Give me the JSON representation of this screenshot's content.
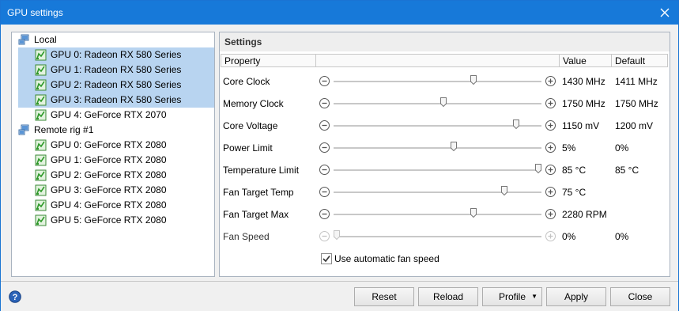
{
  "window": {
    "title": "GPU settings"
  },
  "tree": [
    {
      "label": "Local",
      "type": "group",
      "selected": false
    },
    {
      "label": "GPU 0: Radeon RX 580 Series",
      "type": "gpu",
      "selected": true
    },
    {
      "label": "GPU 1: Radeon RX 580 Series",
      "type": "gpu",
      "selected": true
    },
    {
      "label": "GPU 2: Radeon RX 580 Series",
      "type": "gpu",
      "selected": true
    },
    {
      "label": "GPU 3: Radeon RX 580 Series",
      "type": "gpu",
      "selected": true
    },
    {
      "label": "GPU 4: GeForce RTX 2070",
      "type": "gpu",
      "selected": false
    },
    {
      "label": "Remote rig #1",
      "type": "group",
      "selected": false
    },
    {
      "label": "GPU 0: GeForce RTX 2080",
      "type": "gpu",
      "selected": false
    },
    {
      "label": "GPU 1: GeForce RTX 2080",
      "type": "gpu",
      "selected": false
    },
    {
      "label": "GPU 2: GeForce RTX 2080",
      "type": "gpu",
      "selected": false
    },
    {
      "label": "GPU 3: GeForce RTX 2080",
      "type": "gpu",
      "selected": false
    },
    {
      "label": "GPU 4: GeForce RTX 2080",
      "type": "gpu",
      "selected": false
    },
    {
      "label": "GPU 5: GeForce RTX 2080",
      "type": "gpu",
      "selected": false
    }
  ],
  "settings": {
    "header": "Settings",
    "columns": {
      "property": "Property",
      "value": "Value",
      "default": "Default"
    },
    "rows": [
      {
        "property": "Core Clock",
        "value": "1430 MHz",
        "default": "1411 MHz",
        "level": 0.68,
        "enabled": true
      },
      {
        "property": "Memory Clock",
        "value": "1750 MHz",
        "default": "1750 MHz",
        "level": 0.53,
        "enabled": true
      },
      {
        "property": "Core Voltage",
        "value": "1150 mV",
        "default": "1200 mV",
        "level": 0.89,
        "enabled": true
      },
      {
        "property": "Power Limit",
        "value": "5%",
        "default": "0%",
        "level": 0.58,
        "enabled": true
      },
      {
        "property": "Temperature Limit",
        "value": "85 °C",
        "default": "85 °C",
        "level": 1.0,
        "enabled": true
      },
      {
        "property": "Fan Target Temp",
        "value": "75 °C",
        "default": "",
        "level": 0.83,
        "enabled": true
      },
      {
        "property": "Fan Target Max",
        "value": "2280 RPM",
        "default": "",
        "level": 0.68,
        "enabled": true
      },
      {
        "property": "Fan Speed",
        "value": "0%",
        "default": "0%",
        "level": 0.0,
        "enabled": false
      }
    ],
    "auto_fan": {
      "label": "Use automatic fan speed",
      "checked": true
    }
  },
  "buttons": {
    "reset": "Reset",
    "reload": "Reload",
    "profile": "Profile",
    "apply": "Apply",
    "close": "Close"
  },
  "colors": {
    "titlebar": "#1779d9",
    "selection": "#b8d4f0",
    "gpu_icon": "#3aa935"
  }
}
